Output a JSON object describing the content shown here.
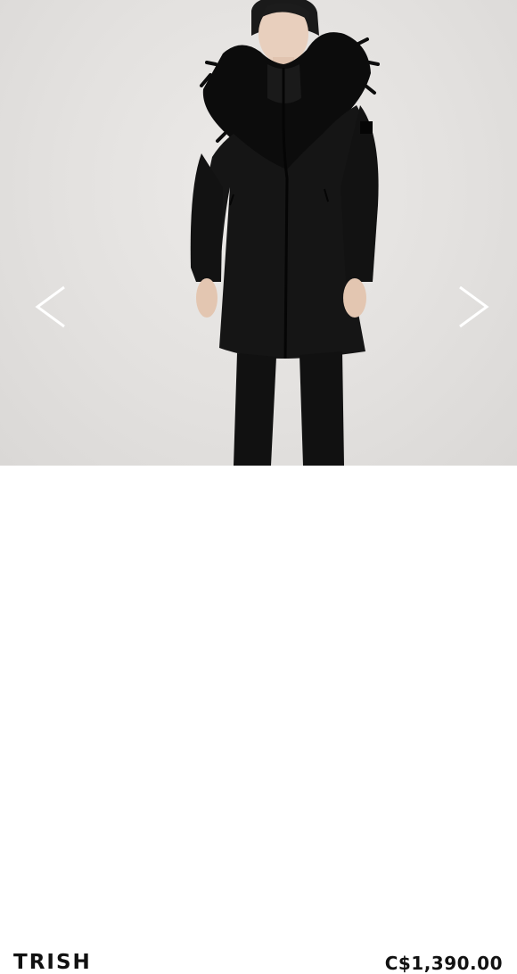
{
  "product": {
    "name": "TRISH",
    "price": "C$1,390.00"
  },
  "carousel": {
    "prev_icon": "chevron-left-icon",
    "next_icon": "chevron-right-icon"
  },
  "colors": {
    "coat": "#141414",
    "background": "#e4e2e0",
    "arrow": "#ffffff"
  }
}
